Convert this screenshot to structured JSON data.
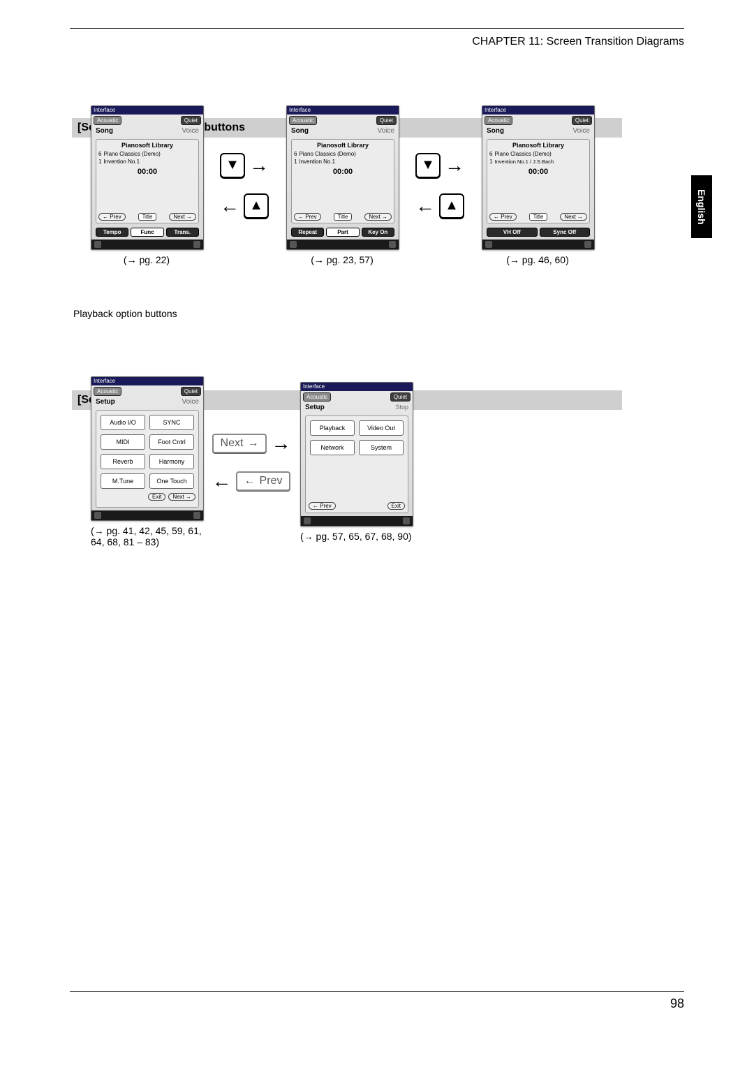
{
  "header": {
    "chapter": "CHAPTER 11: Screen Transition Diagrams"
  },
  "language_tab": "English",
  "page_number": "98",
  "section1": {
    "title": "[Song] playback option buttons",
    "caption": "Playback option buttons",
    "icons": {
      "down": "▼",
      "up": "▲"
    },
    "arrows": {
      "right": "→",
      "left": "←"
    },
    "screens": [
      {
        "window": "Interface",
        "mode_l": "Acoustic",
        "mode_r": "Quiet",
        "title_l": "Song",
        "title_r": "Voice",
        "library": "Pianosoft Library",
        "row1_no": "6",
        "row1": "Piano Classics (Demo)",
        "row2_no": "1",
        "row2": "Invention No.1",
        "time": "00:00",
        "nav_prev": "← Prev",
        "nav_mid": "Title",
        "nav_next": "Next →",
        "opts": [
          "Tempo",
          "Func",
          "Trans."
        ],
        "ref": "(→ pg. 22)"
      },
      {
        "window": "Interface",
        "mode_l": "Acoustic",
        "mode_r": "Quiet",
        "title_l": "Song",
        "title_r": "Voice",
        "library": "Pianosoft Library",
        "row1_no": "6",
        "row1": "Piano Classics (Demo)",
        "row2_no": "1",
        "row2": "Invention No.1",
        "time": "00:00",
        "nav_prev": "← Prev",
        "nav_mid": "Title",
        "nav_next": "Next →",
        "opts": [
          "Repeat",
          "Part",
          "Key On"
        ],
        "ref": "(→ pg. 23, 57)"
      },
      {
        "window": "Interface",
        "mode_l": "Acoustic",
        "mode_r": "Quiet",
        "title_l": "Song",
        "title_r": "Voice",
        "library": "Pianosoft Library",
        "row1_no": "6",
        "row1": "Piano Classics (Demo)",
        "row2_no": "1",
        "row2": "Invention No.1 / J.S.Bach",
        "time": "00:00",
        "nav_prev": "← Prev",
        "nav_mid": "Title",
        "nav_next": "Next →",
        "opts": [
          "VH Off",
          "Sync Off"
        ],
        "ref": "(→ pg. 46, 60)"
      }
    ]
  },
  "section2": {
    "title": "[Setup] menu screens",
    "labels": {
      "next": "Next",
      "prev": "Prev"
    },
    "arrows": {
      "right": "→",
      "left": "←"
    },
    "screens": [
      {
        "window": "Interface",
        "mode_l": "Acoustic",
        "mode_r": "Quiet",
        "title_l": "Setup",
        "title_r": "Voice",
        "cells": [
          "Audio I/O",
          "SYNC",
          "MIDI",
          "Foot Cntrl",
          "Reverb",
          "Harmony",
          "M.Tune",
          "One Touch"
        ],
        "nav_prev": "",
        "nav_exit": "Exit",
        "nav_next": "Next →",
        "ref": "(→ pg. 41, 42, 45, 59, 61, 64, 68, 81 – 83)"
      },
      {
        "window": "Interface",
        "mode_l": "Acoustic",
        "mode_r": "Quiet",
        "title_l": "Setup",
        "title_r": "Stop",
        "cells": [
          "Playback",
          "Video Out",
          "Network",
          "System"
        ],
        "nav_prev": "← Prev",
        "nav_exit": "Exit",
        "nav_next": "",
        "ref": "(→ pg. 57, 65, 67, 68, 90)"
      }
    ]
  }
}
